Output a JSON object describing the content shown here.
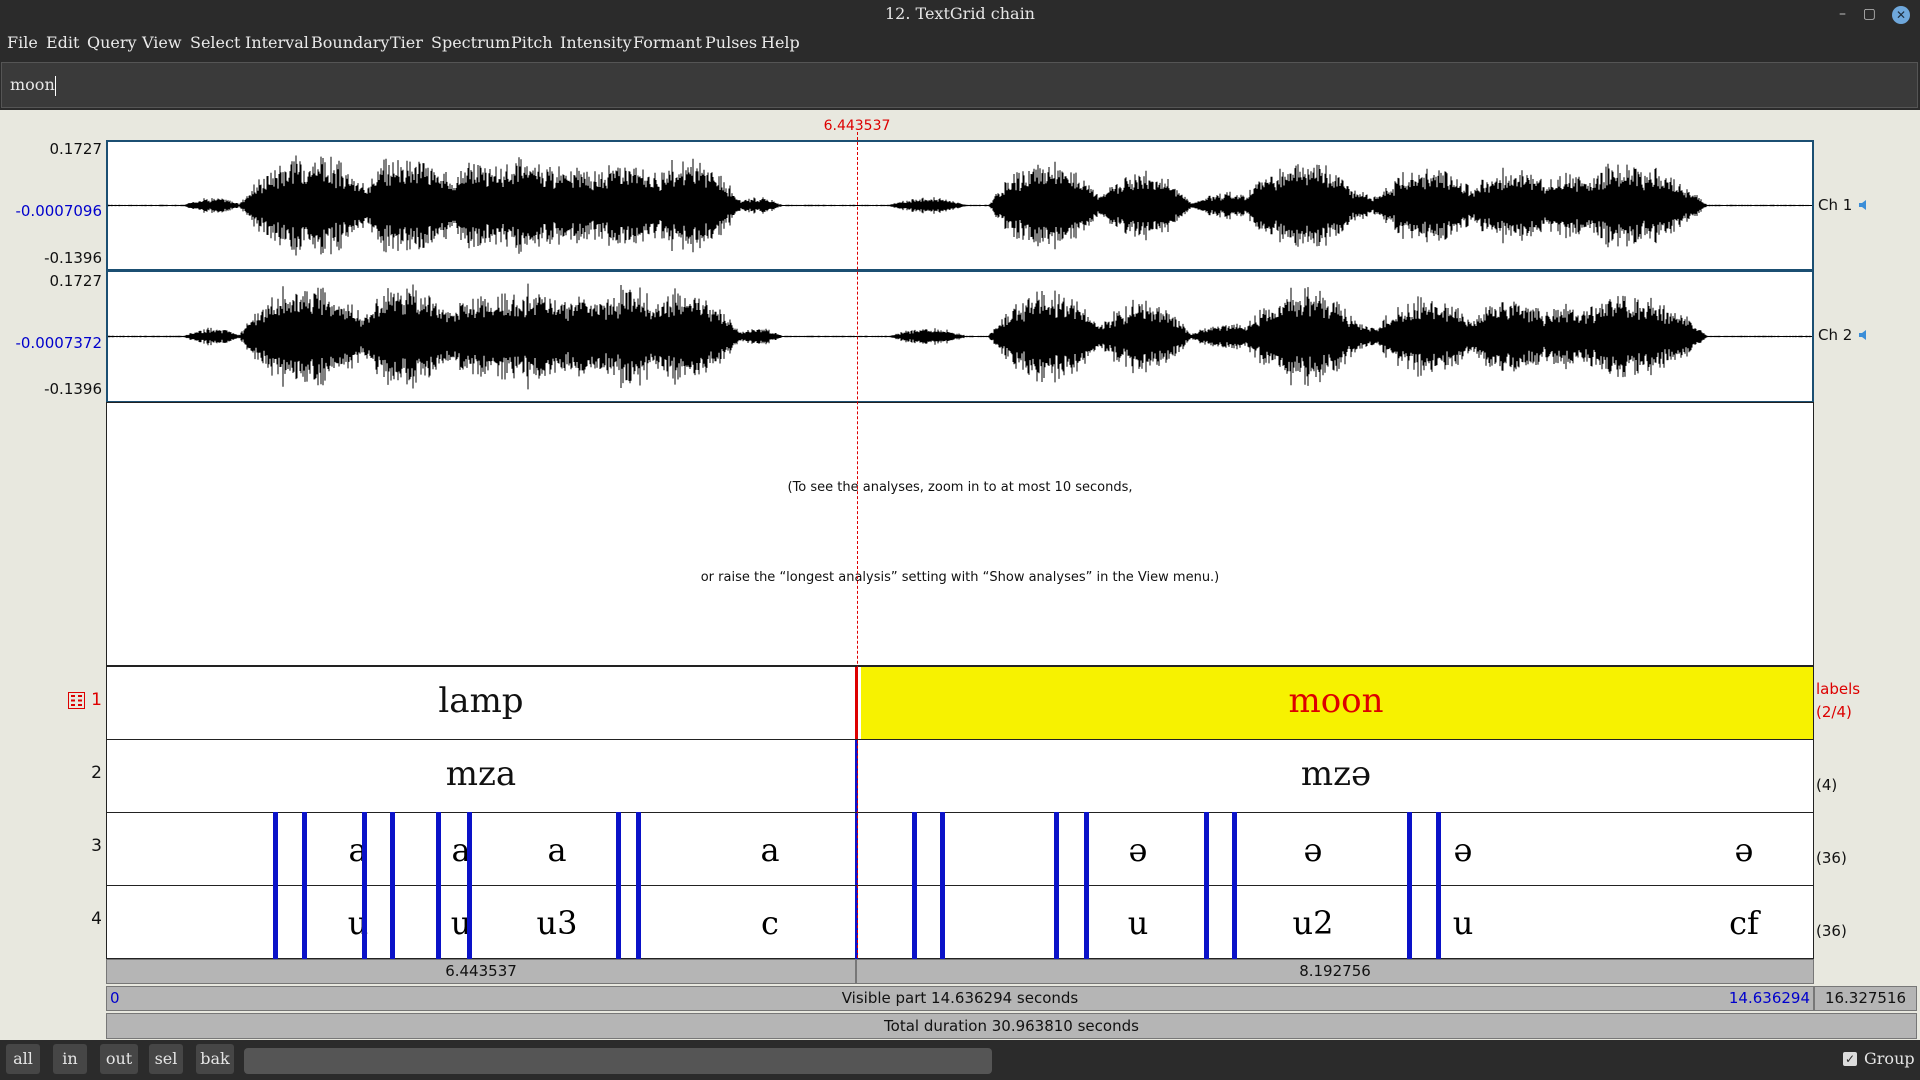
{
  "window": {
    "title": "12. TextGrid chain",
    "minimize": "–",
    "maximize": "▢",
    "close": "✕"
  },
  "menu": [
    "File",
    "Edit",
    "Query",
    "View",
    "Select",
    "Interval",
    "Boundary",
    "Tier",
    "Spectrum",
    "Pitch",
    "Intensity",
    "Formant",
    "Pulses",
    "Help"
  ],
  "text_field": {
    "value": "moon"
  },
  "cursor_time": "6.443537",
  "channels": [
    {
      "label": "Ch 1",
      "max": "0.1727",
      "mid": "-0.0007096",
      "min": "-0.1396",
      "icon": "speaker-icon"
    },
    {
      "label": "Ch 2",
      "max": "0.1727",
      "mid": "-0.0007372",
      "min": "-0.1396",
      "icon": "speaker-icon"
    }
  ],
  "analysis_notice": {
    "line1": "(To see the analyses, zoom in to at most 10 seconds,",
    "line2": "or raise the “longest analysis” setting with “Show analyses” in the View menu.)"
  },
  "tiers": [
    {
      "number": "1",
      "side": "labels",
      "count": "(2/4)",
      "intervals": [
        "lamp",
        "moon"
      ],
      "selected_interval": "moon",
      "selected_color": "#f7f200"
    },
    {
      "number": "2",
      "side": "",
      "count": "(4)",
      "intervals": [
        "mza",
        "mzə"
      ]
    },
    {
      "number": "3",
      "side": "",
      "count": "(36)",
      "intervals": [
        "a",
        "a",
        "a",
        "a",
        "ə",
        "ə",
        "ə",
        "ə"
      ]
    },
    {
      "number": "4",
      "side": "",
      "count": "(36)",
      "intervals": [
        "u",
        "u",
        "u3",
        "c",
        "u",
        "u2",
        "u",
        "cf"
      ]
    }
  ],
  "durations": {
    "left": "6.443537",
    "right": "8.192756"
  },
  "visible": {
    "start": "0",
    "label": "Visible part 14.636294 seconds",
    "end": "14.636294",
    "right_total": "16.327516"
  },
  "total": {
    "label": "Total duration 30.963810 seconds"
  },
  "nav_buttons": [
    "all",
    "in",
    "out",
    "sel",
    "bak"
  ],
  "group": {
    "label": "Group",
    "checked": true
  },
  "colors": {
    "boundary": "#0a12c8",
    "cursor": "#dd0000",
    "axis_mid": "#0000cc",
    "selected": "#f7f200"
  }
}
